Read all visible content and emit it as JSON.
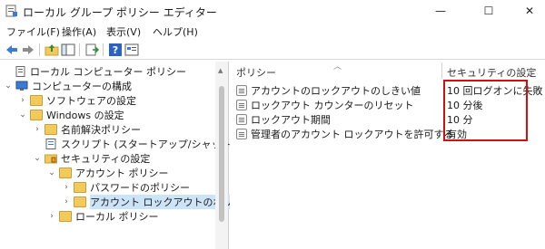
{
  "window": {
    "title": "ローカル グループ ポリシー エディター",
    "minimize": "—",
    "maximize": "☐",
    "close": "✕"
  },
  "menu": [
    "ファイル(F)",
    "操作(A)",
    "表示(V)",
    "ヘルプ(H)"
  ],
  "toolbar": {
    "icons": [
      "back-arrow-icon",
      "forward-arrow-icon",
      "up-folder-icon",
      "show-hide-tree-icon",
      "export-list-icon",
      "help-icon",
      "properties-icon"
    ]
  },
  "tree": {
    "items": [
      {
        "label": "ローカル コンピューター ポリシー",
        "expander": "",
        "icon": "policy-doc-icon"
      },
      {
        "label": "コンピューターの構成",
        "expander": "⌄",
        "icon": "computer-icon"
      },
      {
        "label": "ソフトウェアの設定",
        "expander": "›",
        "icon": "folder-icon"
      },
      {
        "label": "Windows の設定",
        "expander": "⌄",
        "icon": "folder-icon"
      },
      {
        "label": "名前解決ポリシー",
        "expander": "›",
        "icon": "folder-icon"
      },
      {
        "label": "スクリプト (スタートアップ/シャットダウン)",
        "expander": "",
        "icon": "script-icon"
      },
      {
        "label": "セキュリティの設定",
        "expander": "⌄",
        "icon": "security-folder-icon"
      },
      {
        "label": "アカウント ポリシー",
        "expander": "⌄",
        "icon": "folder-icon"
      },
      {
        "label": "パスワードのポリシー",
        "expander": "›",
        "icon": "folder-icon"
      },
      {
        "label": "アカウント ロックアウトのポリシー",
        "expander": "›",
        "icon": "folder-icon"
      },
      {
        "label": "ローカル ポリシー",
        "expander": "›",
        "icon": "folder-icon"
      }
    ]
  },
  "table": {
    "headers": [
      "ポリシー",
      "セキュリティの設定"
    ],
    "rows": [
      {
        "policy": "アカウントのロックアウトのしきい値",
        "setting": "10 回ログオンに失敗"
      },
      {
        "policy": "ロックアウト カウンターのリセット",
        "setting": "10 分後"
      },
      {
        "policy": "ロックアウト期間",
        "setting": "10 分"
      },
      {
        "policy": "管理者のアカウント ロックアウトを許可する",
        "setting": "有効"
      }
    ]
  },
  "colors": {
    "highlight_border": "#d10f0f",
    "selection": "#cce4f7",
    "folder": "#f3c95a"
  }
}
